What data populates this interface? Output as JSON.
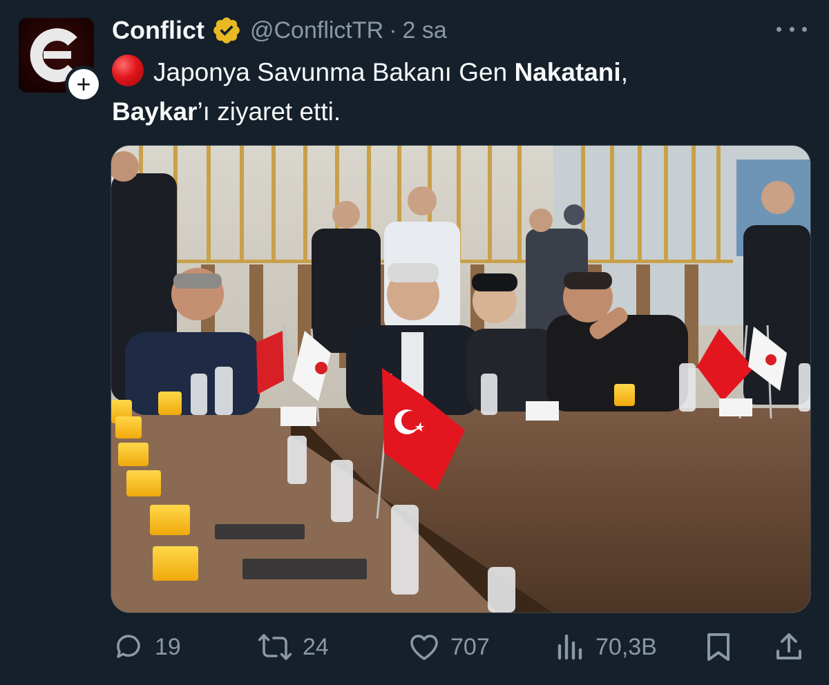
{
  "account": {
    "display_name": "Conflict",
    "handle": "@ConflictTR",
    "separator": "·",
    "time": "2 sa",
    "verified_badge_color": "#e8b923"
  },
  "tweet": {
    "text_part1": "Japonya Savunma Bakanı Gen ",
    "text_bold1": "Nakatani",
    "text_part2": ",",
    "text_bold2": "Baykar",
    "text_part3": "’ı ziyaret etti.",
    "emoji": "red-circle",
    "media_description_icon": "photo"
  },
  "actions": {
    "replies": "19",
    "retweets": "24",
    "likes": "707",
    "views": "70,3B"
  },
  "colors": {
    "background": "#15202b",
    "text": "#f7f9f9",
    "secondary_text": "#8b98a5",
    "accent_red": "#e0151b"
  }
}
